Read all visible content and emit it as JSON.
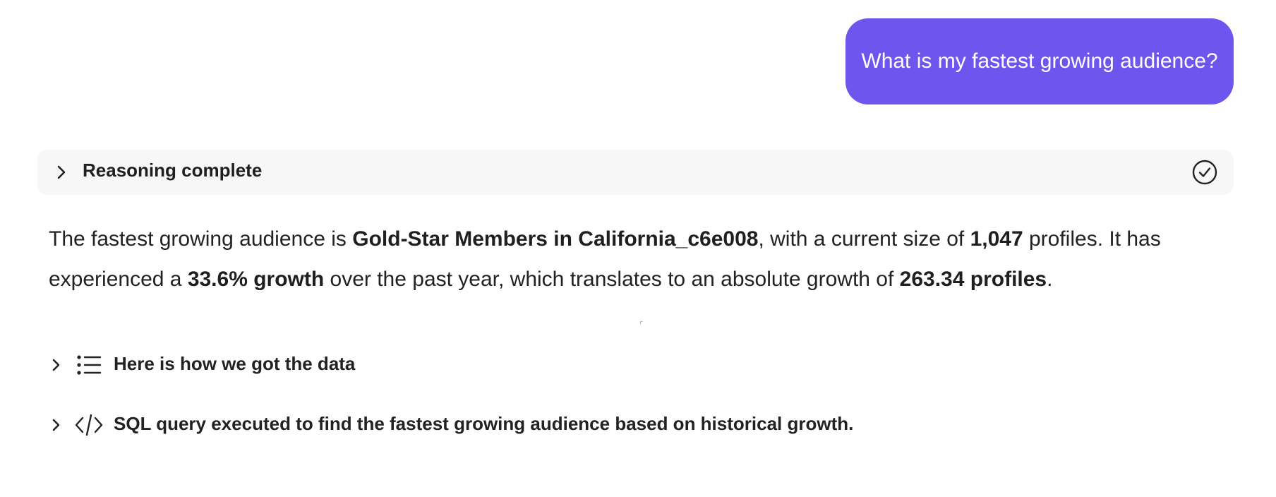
{
  "user_message": {
    "text": "What is my fastest growing audience?",
    "bubble_color": "#6e55ee"
  },
  "reasoning": {
    "label": "Reasoning complete",
    "chevron_icon": "chevron-right-icon",
    "status_icon": "check-circle-icon"
  },
  "answer": {
    "p1": "The fastest growing audience is ",
    "audience_name": "Gold-Star Members in California_c6e008",
    "p2": ", with a current size of ",
    "current_size": "1,047",
    "p3": " profiles. It has experienced a ",
    "growth": "33.6% growth",
    "p4": " over the past year, which translates to an absolute growth of ",
    "absolute_growth": "263.34 profiles",
    "p5": "."
  },
  "sections": [
    {
      "label": "Here is how we got the data",
      "icon": "list-icon"
    },
    {
      "label": "SQL query executed to find the fastest growing audience based on historical growth.",
      "icon": "code-icon"
    }
  ]
}
